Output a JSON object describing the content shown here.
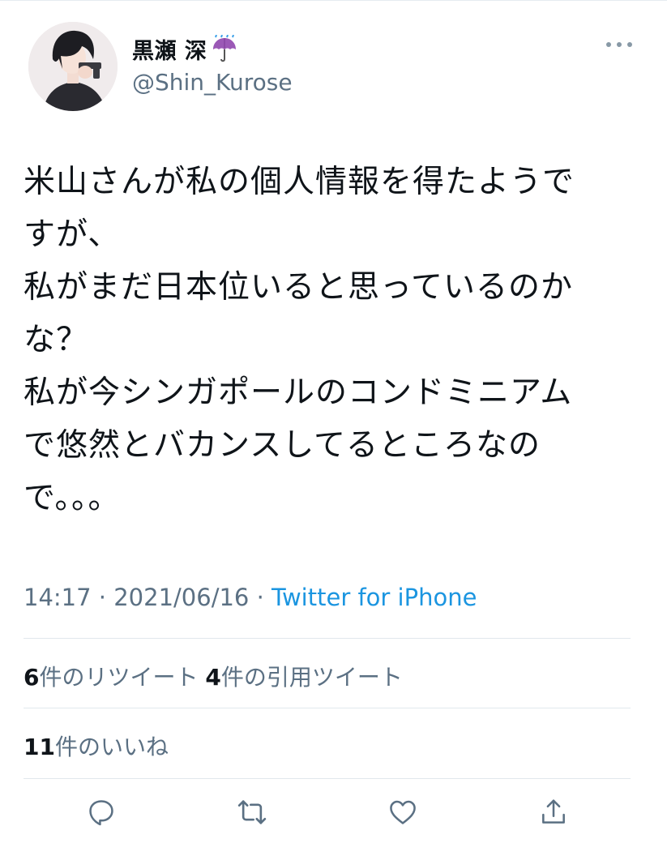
{
  "user": {
    "display_name": "黒瀬 深",
    "emoji_icon": "umbrella-with-rain-icon",
    "handle": "@Shin_Kurose"
  },
  "tweet": {
    "lines": [
      "米山さんが私の個人情報を得たようで",
      "すが、",
      "私がまだ日本位いると思っているのか",
      "な？",
      "私が今シンガポールのコンドミニアム",
      "で悠然とバカンスしてるところなの",
      "で。。。"
    ],
    "time": "14:17",
    "separator": " · ",
    "date": "2021/06/16",
    "source": "Twitter for iPhone"
  },
  "stats": {
    "retweets_count": "6",
    "retweets_label": "件のリツイート",
    "quotes_count": "4",
    "quotes_label": "件の引用ツイート",
    "likes_count": "11",
    "likes_label": "件のいいね"
  },
  "actions": [
    "reply-icon",
    "retweet-icon",
    "like-icon",
    "share-icon"
  ],
  "colors": {
    "text": "#0f1419",
    "secondary": "#5b7083",
    "link": "#1b95e0",
    "divider": "#e1e8ed"
  }
}
